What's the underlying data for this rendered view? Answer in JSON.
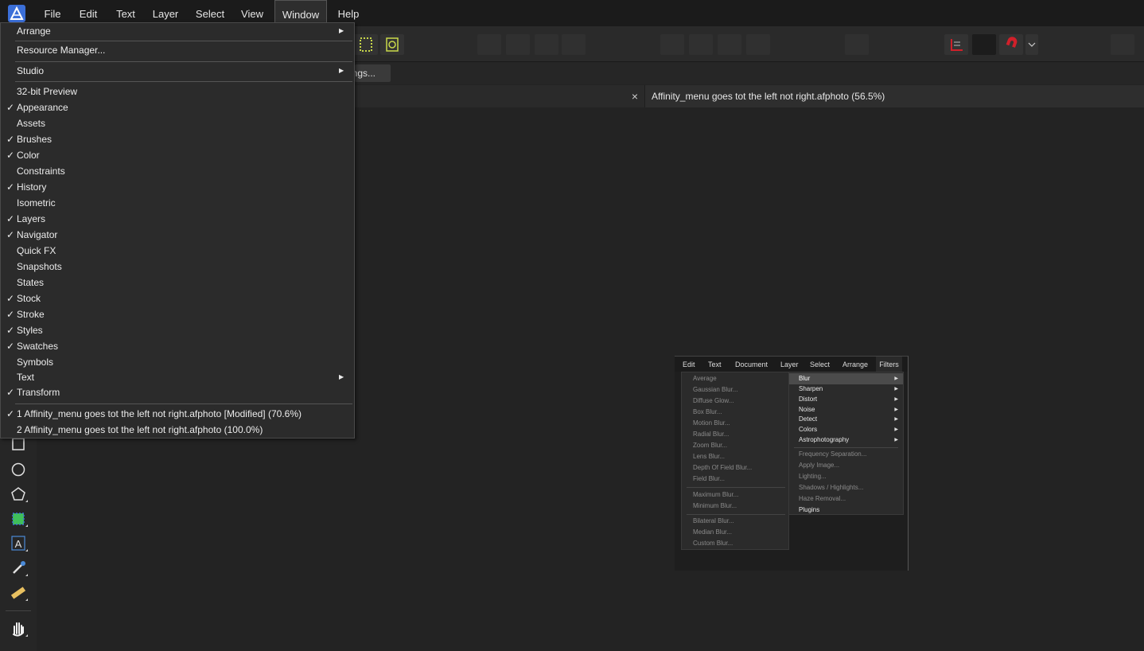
{
  "menubar": {
    "items": [
      "File",
      "Edit",
      "Text",
      "Layer",
      "Select",
      "View",
      "Window",
      "Help"
    ],
    "active": "Window"
  },
  "context_bar": {
    "button_label": "ings..."
  },
  "tabs": {
    "close_glyph": "×",
    "document_title": "Affinity_menu goes tot the left not right.afphoto (56.5%)"
  },
  "window_menu": {
    "arrange": "Arrange",
    "resource_manager": "Resource Manager...",
    "studio": "Studio",
    "preview": "32-bit Preview",
    "panels": [
      {
        "label": "Appearance",
        "checked": true
      },
      {
        "label": "Assets",
        "checked": false
      },
      {
        "label": "Brushes",
        "checked": true
      },
      {
        "label": "Color",
        "checked": true
      },
      {
        "label": "Constraints",
        "checked": false
      },
      {
        "label": "History",
        "checked": true
      },
      {
        "label": "Isometric",
        "checked": false
      },
      {
        "label": "Layers",
        "checked": true
      },
      {
        "label": "Navigator",
        "checked": true
      },
      {
        "label": "Quick FX",
        "checked": false
      },
      {
        "label": "Snapshots",
        "checked": false
      },
      {
        "label": "States",
        "checked": false
      },
      {
        "label": "Stock",
        "checked": true
      },
      {
        "label": "Stroke",
        "checked": true
      },
      {
        "label": "Styles",
        "checked": true
      },
      {
        "label": "Swatches",
        "checked": true
      },
      {
        "label": "Symbols",
        "checked": false
      },
      {
        "label": "Text",
        "checked": false
      },
      {
        "label": "Transform",
        "checked": true
      }
    ],
    "documents": [
      {
        "label": "1 Affinity_menu goes tot the left not right.afphoto [Modified] (70.6%)",
        "checked": true
      },
      {
        "label": "2 Affinity_menu goes tot the left not right.afphoto (100.0%)",
        "checked": false
      }
    ],
    "check_glyph": "✓",
    "submenu_glyph": "▶"
  },
  "embedded": {
    "menubar": [
      "Edit",
      "Text",
      "Document",
      "Layer",
      "Select",
      "Arrange",
      "Filters"
    ],
    "blur_items": [
      "Average",
      "Gaussian Blur...",
      "Diffuse Glow...",
      "Box Blur...",
      "Motion Blur...",
      "Radial Blur...",
      "Zoom Blur...",
      "Lens Blur...",
      "Depth Of Field Blur...",
      "Field Blur..."
    ],
    "blur_items_2": [
      "Maximum Blur...",
      "Minimum Blur..."
    ],
    "blur_items_3": [
      "Bilateral Blur...",
      "Median Blur...",
      "Custom Blur..."
    ],
    "filter_submenus": [
      "Blur",
      "Sharpen",
      "Distort",
      "Noise",
      "Detect",
      "Colors",
      "Astrophotography"
    ],
    "filter_items": [
      "Frequency Separation...",
      "Apply Image...",
      "Lighting...",
      "Shadows / Highlights...",
      "Haze Removal..."
    ],
    "plugins": "Plugins"
  },
  "colors": {
    "menubar_bg": "#1b1b1b",
    "menu_bg": "#2b2b2b",
    "canvas_bg": "#232323",
    "accent_red": "#d0202a",
    "accent_green": "#3fbf5a"
  }
}
